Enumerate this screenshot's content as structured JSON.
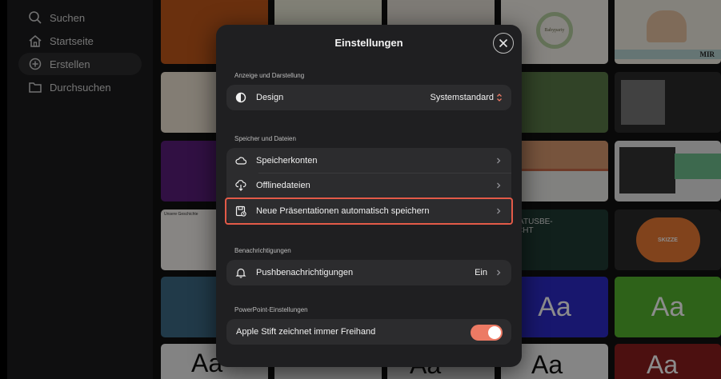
{
  "sidebar": {
    "items": [
      {
        "label": "Suchen",
        "icon": "search-icon"
      },
      {
        "label": "Startseite",
        "icon": "home-icon"
      },
      {
        "label": "Erstellen",
        "icon": "plus-circle-icon",
        "active": true
      },
      {
        "label": "Durchsuchen",
        "icon": "folder-icon"
      }
    ]
  },
  "gallery": {
    "tile_texts": {
      "babyparty": "Babyparty",
      "mir": "MIR",
      "statusbericht": "STATUSBE-\nRICHT",
      "skizze": "SKIZZE",
      "aa": "Aa",
      "unsere_geschichte": "Unsere Geschichte"
    }
  },
  "modal": {
    "title": "Einstellungen",
    "sections": {
      "display": {
        "label": "Anzeige und Darstellung",
        "design": {
          "label": "Design",
          "value": "Systemstandard"
        }
      },
      "storage": {
        "label": "Speicher und Dateien",
        "accounts": {
          "label": "Speicherkonten"
        },
        "offline": {
          "label": "Offlinedateien"
        },
        "autosave": {
          "label": "Neue Präsentationen automatisch speichern"
        }
      },
      "notifications": {
        "label": "Benachrichtigungen",
        "push": {
          "label": "Pushbenachrichtigungen",
          "value": "Ein"
        }
      },
      "powerpoint": {
        "label": "PowerPoint-Einstellungen",
        "pencil": {
          "label": "Apple Stift zeichnet immer Freihand",
          "enabled": true
        }
      }
    }
  },
  "colors": {
    "highlight": "#e35a48",
    "toggle_on": "#ec7a64",
    "panel": "#1f1f21",
    "group": "#2c2c2e"
  }
}
